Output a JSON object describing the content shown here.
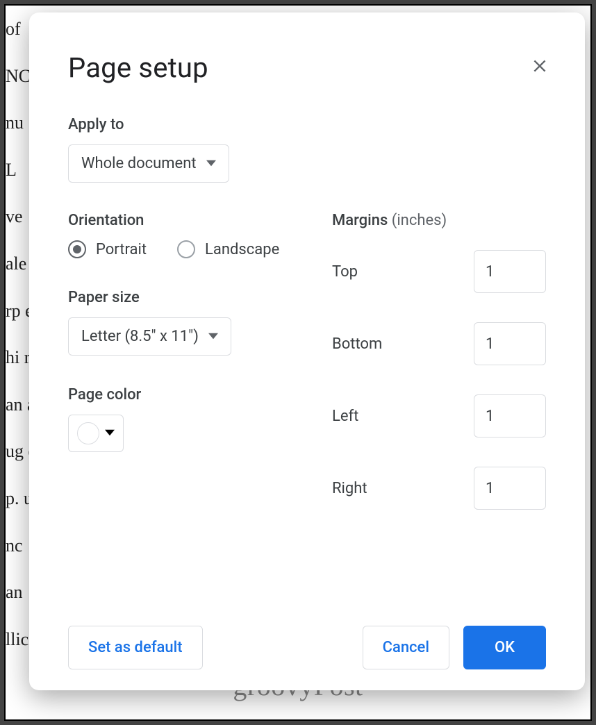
{
  "background_text": {
    "lines": [
      "of",
      "NC",
      "nu",
      "                                                                                                                                              L",
      "                                                                                                                                             ve",
      "ale                                                                                                                                          us",
      "rp                                                                                                                                            e",
      "hi                                                                                                                                           rp",
      "an                                                                                                                                            a",
      "ug                                                                                                                                           ec",
      "p.                                                                                                                                           us",
      "nc",
      "                                                                                                                                             an",
      "llicitudin ullamcorper. Nullam at purus eu leo blandit facilisis sit an"
    ]
  },
  "watermark": "groovyPost",
  "dialog": {
    "title": "Page setup",
    "apply_to": {
      "label": "Apply to",
      "value": "Whole document"
    },
    "orientation": {
      "label": "Orientation",
      "portrait": "Portrait",
      "landscape": "Landscape",
      "selected": "portrait"
    },
    "paper_size": {
      "label": "Paper size",
      "value": "Letter (8.5\" x 11\")"
    },
    "page_color": {
      "label": "Page color",
      "value": "#ffffff"
    },
    "margins": {
      "label": "Margins",
      "unit": "(inches)",
      "top": {
        "label": "Top",
        "value": "1"
      },
      "bottom": {
        "label": "Bottom",
        "value": "1"
      },
      "left": {
        "label": "Left",
        "value": "1"
      },
      "right": {
        "label": "Right",
        "value": "1"
      }
    },
    "buttons": {
      "set_default": "Set as default",
      "cancel": "Cancel",
      "ok": "OK"
    }
  }
}
